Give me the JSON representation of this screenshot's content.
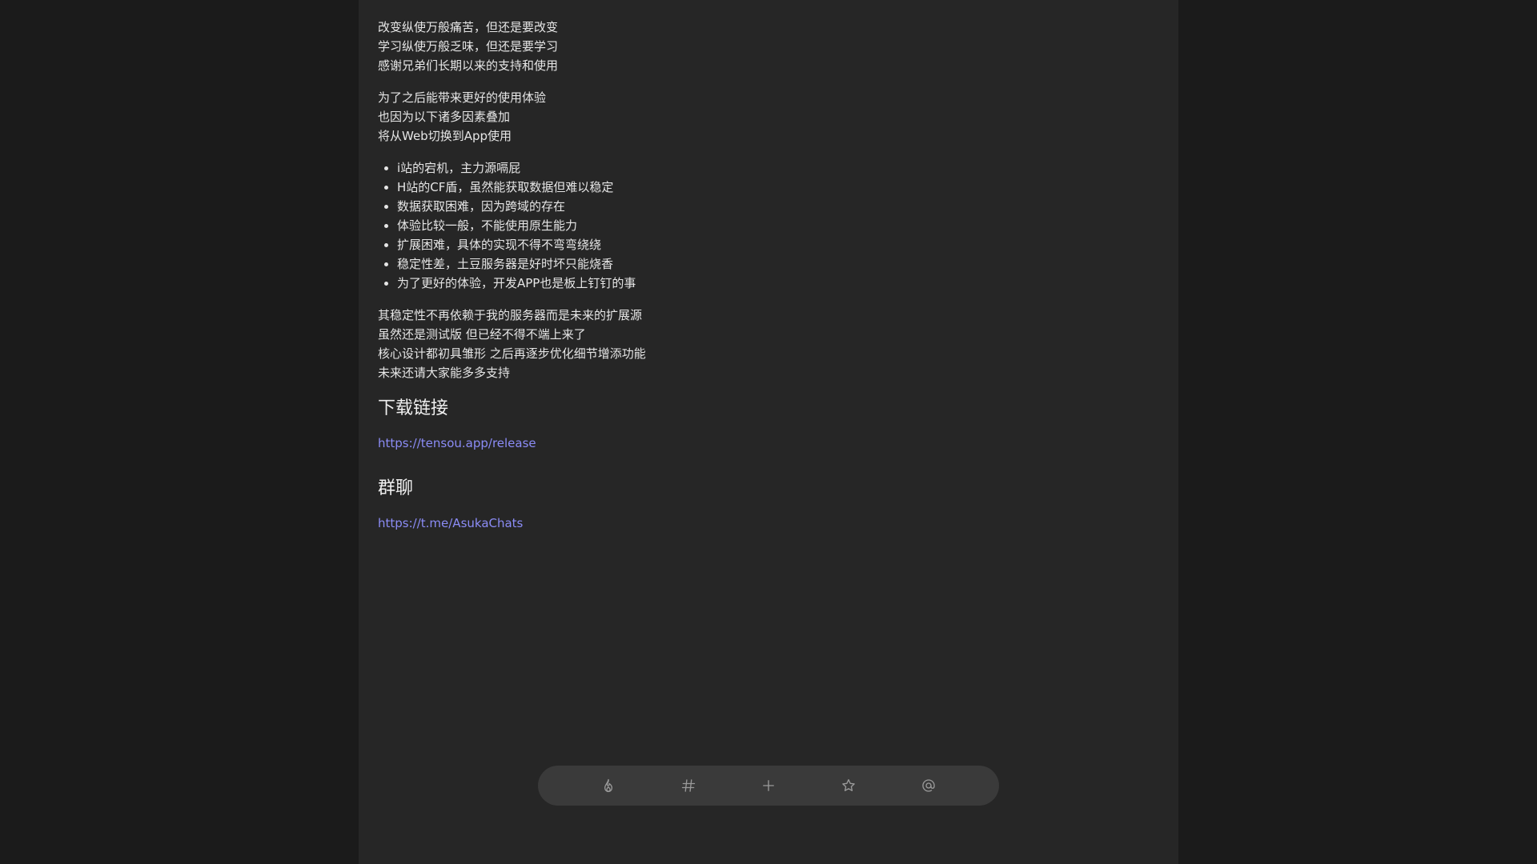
{
  "intro": {
    "lines": [
      "改变纵使万般痛苦，但还是要改变",
      "学习纵使万般乏味，但还是要学习",
      "感谢兄弟们长期以来的支持和使用"
    ]
  },
  "reason": {
    "lines": [
      "为了之后能带来更好的使用体验",
      "也因为以下诸多因素叠加",
      "将从Web切换到App使用"
    ]
  },
  "bullets": [
    "i站的宕机，主力源嗝屁",
    "H站的CF盾，虽然能获取数据但难以稳定",
    "数据获取困难，因为跨域的存在",
    "体验比较一般，不能使用原生能力",
    "扩展困难，具体的实现不得不弯弯绕绕",
    "稳定性差，土豆服务器是好时坏只能烧香",
    "为了更好的体验，开发APP也是板上钉钉的事"
  ],
  "outro": {
    "lines": [
      "其稳定性不再依赖于我的服务器而是未来的扩展源",
      "虽然还是测试版 但已经不得不端上来了",
      "核心设计都初具雏形 之后再逐步优化细节增添功能",
      "未来还请大家能多多支持"
    ]
  },
  "download": {
    "heading": "下载链接",
    "link": "https://tensou.app/release"
  },
  "group": {
    "heading": "群聊",
    "link": "https://t.me/AsukaChats"
  },
  "nav": {
    "items": [
      {
        "icon": "fire-icon"
      },
      {
        "icon": "hashtag-icon"
      },
      {
        "icon": "plus-icon"
      },
      {
        "icon": "star-icon"
      },
      {
        "icon": "at-icon"
      }
    ]
  },
  "colors": {
    "background": "#1b1b1b",
    "panel": "#262626",
    "text": "#e6e6e6",
    "link": "#8b8cf6",
    "nav_bar": "#3a3a3a",
    "nav_icon": "#9a9a9a"
  }
}
